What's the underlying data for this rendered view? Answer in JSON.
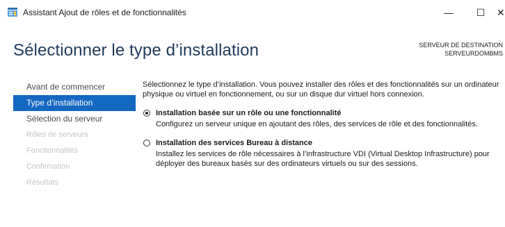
{
  "window": {
    "title": "Assistant Ajout de rôles et de fonctionnalités",
    "app_icon": "server-manager-icon",
    "controls": {
      "minimize": "—",
      "maximize": "☐",
      "close": "✕"
    }
  },
  "header": {
    "page_title": "Sélectionner le type d’installation",
    "destination_label": "SERVEUR DE DESTINATION",
    "destination_server": "SERVEURDOMBMS"
  },
  "nav": {
    "items": [
      {
        "label": "Avant de commencer",
        "state": "normal"
      },
      {
        "label": "Type d’installation",
        "state": "active"
      },
      {
        "label": "Sélection du serveur",
        "state": "normal"
      },
      {
        "label": "Rôles de serveurs",
        "state": "disabled"
      },
      {
        "label": "Fonctionnalités",
        "state": "disabled"
      },
      {
        "label": "Confirmation",
        "state": "disabled"
      },
      {
        "label": "Résultats",
        "state": "disabled"
      }
    ]
  },
  "main": {
    "intro": "Sélectionnez le type d’installation. Vous pouvez installer des rôles et des fonctionnalités sur un ordinateur physique ou virtuel en fonctionnement, ou sur un disque dur virtuel hors connexion.",
    "options": [
      {
        "label": "Installation basée sur un rôle ou une fonctionnalité",
        "description": "Configurez un serveur unique en ajoutant des rôles, des services de rôle et des fonctionnalités.",
        "selected": true
      },
      {
        "label": "Installation des services Bureau à distance",
        "description": "Installez les services de rôle nécessaires à l’infrastructure VDI (Virtual Desktop Infrastructure) pour déployer des bureaux basés sur des ordinateurs virtuels ou sur des sessions.",
        "selected": false
      }
    ]
  },
  "colors": {
    "accent": "#1468c2",
    "title": "#1f3a5a",
    "disabled": "#c4c4c4"
  }
}
